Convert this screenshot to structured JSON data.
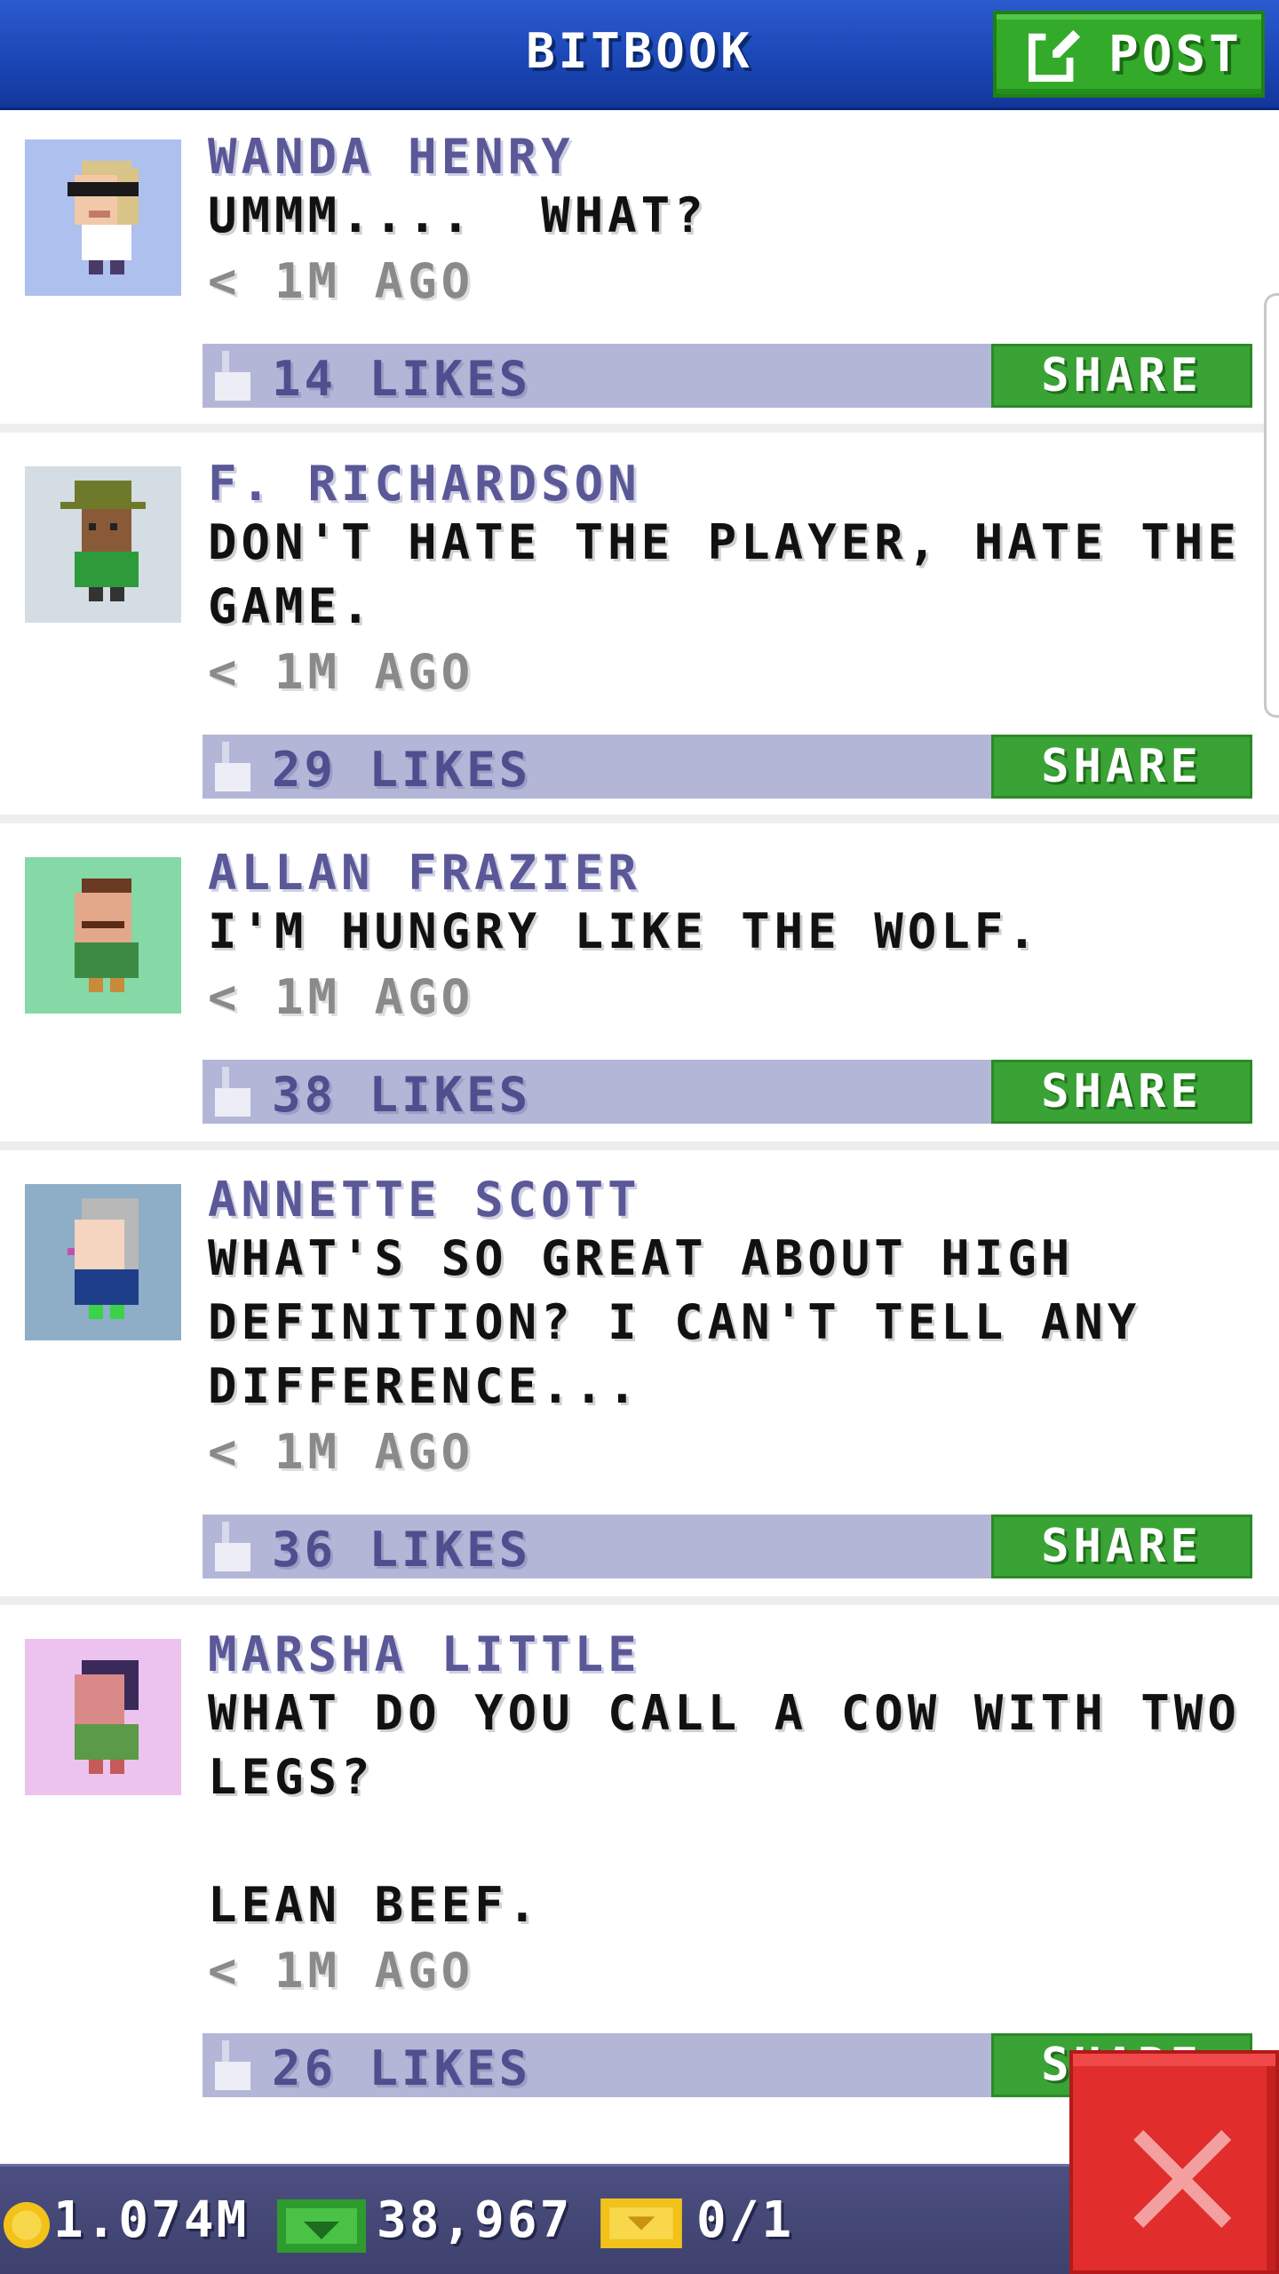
{
  "header": {
    "title": "BITBOOK",
    "post_label": "POST",
    "post_icon": "edit-icon",
    "colors": {
      "bar": "#1a45b3",
      "post_button": "#33aa2a"
    }
  },
  "posts": [
    {
      "author": "WANDA HENRY",
      "message": "UMMM....  WHAT?",
      "time": "< 1M AGO",
      "likes": "14 LIKES",
      "share_label": "SHARE",
      "avatar_bg": "#aec0ee"
    },
    {
      "author": "F. RICHARDSON",
      "message": "DON'T HATE THE PLAYER, HATE THE\nGAME.",
      "time": "< 1M AGO",
      "likes": "29 LIKES",
      "share_label": "SHARE",
      "avatar_bg": "#d3dde3"
    },
    {
      "author": "ALLAN FRAZIER",
      "message": "I'M HUNGRY LIKE THE WOLF.",
      "time": "< 1M AGO",
      "likes": "38 LIKES",
      "share_label": "SHARE",
      "avatar_bg": "#84d9a6"
    },
    {
      "author": "ANNETTE SCOTT",
      "message": "WHAT'S SO GREAT ABOUT HIGH\nDEFINITION? I CAN'T TELL ANY\nDIFFERENCE...",
      "time": "< 1M AGO",
      "likes": "36 LIKES",
      "share_label": "SHARE",
      "avatar_bg": "#8eadc7"
    },
    {
      "author": "MARSHA LITTLE",
      "message": "WHAT DO YOU CALL A COW WITH TWO\nLEGS?\n\nLEAN BEEF.",
      "time": "< 1M AGO",
      "likes": "26 LIKES",
      "share_label": "SHARE",
      "avatar_bg": "#ecc3ee"
    }
  ],
  "statusbar": {
    "coins": "1.074M",
    "bux": "38,967",
    "tickets": "0/1"
  },
  "close_button": {
    "icon": "close-icon",
    "color": "#e22d2d"
  }
}
